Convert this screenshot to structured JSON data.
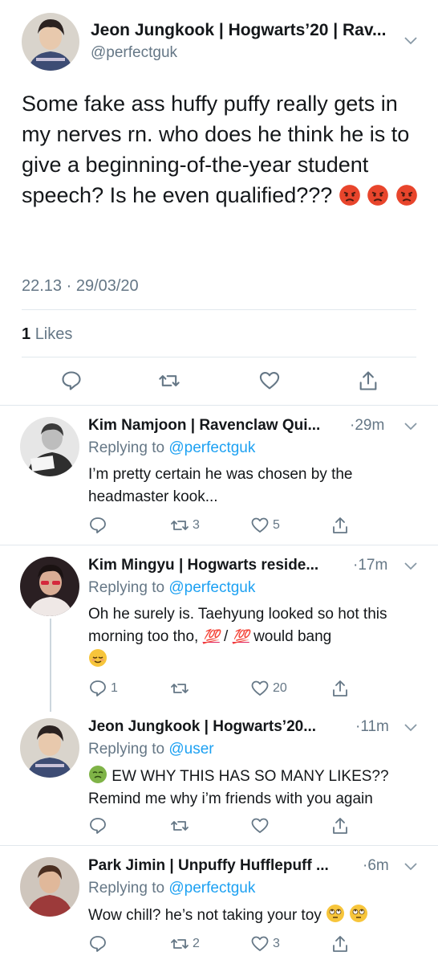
{
  "main_tweet": {
    "display_name": "Jeon Jungkook | Hogwarts’20 | Rav...",
    "handle": "@perfectguk",
    "text": "Some fake ass huffy puffy really gets in my nerves rn. who does he think he is to give a beginning-of-the-year student speech? Is he even qualified???",
    "timestamp": "22.13 · 29/03/20",
    "likes_count": "1",
    "likes_label": "Likes",
    "action_icons": [
      "reply-icon",
      "retweet-icon",
      "like-icon",
      "share-icon"
    ],
    "emojis": [
      "angry-face",
      "angry-face",
      "angry-face"
    ]
  },
  "replies": [
    {
      "display_name": "Kim Namjoon | Ravenclaw Qui...",
      "time": "·29m",
      "replying_prefix": "Replying to",
      "replying_to": "@perfectguk",
      "text": "I’m pretty certain he was chosen by the headmaster kook...",
      "reply_count": "",
      "retweet_count": "3",
      "like_count": "5"
    },
    {
      "display_name": "Kim Mingyu | Hogwarts reside...",
      "time": "·17m",
      "replying_prefix": "Replying to",
      "replying_to": "@perfectguk",
      "text_before": "Oh he surely is. Taehyung looked so hot this morning too tho,",
      "hundred_1": "💯",
      "slash": "/",
      "hundred_2": "💯",
      "text_after": "would bang",
      "reply_count": "1",
      "retweet_count": "",
      "like_count": "20"
    },
    {
      "display_name": "Jeon Jungkook | Hogwarts’20...",
      "time": "·11m",
      "replying_prefix": "Replying to",
      "replying_to": "@user",
      "text_line1": "EW WHY THIS HAS SO MANY LIKES??",
      "text_line2": "Remind me why i’m friends with you again",
      "reply_count": "",
      "retweet_count": "",
      "like_count": ""
    },
    {
      "display_name": "Park Jimin | Unpuffy Hufflepuff ...",
      "time": "·6m",
      "replying_prefix": "Replying to",
      "replying_to": "@perfectguk",
      "text": "Wow chill? he’s not taking your toy",
      "reply_count": "",
      "retweet_count": "2",
      "like_count": "3"
    }
  ],
  "colors": {
    "text": "#14171a",
    "secondary": "#657786",
    "accent": "#1da1f2",
    "separator": "#e1e8ed",
    "thread_line": "#ccd6dd"
  }
}
